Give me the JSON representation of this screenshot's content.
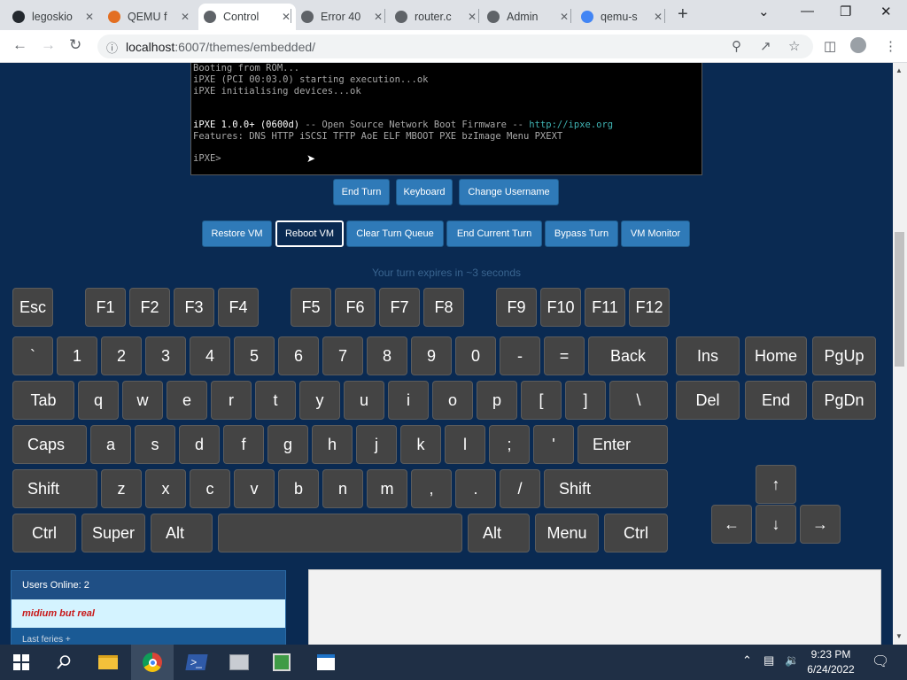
{
  "browser": {
    "tabs": [
      {
        "title": "legoskio",
        "icon": "github-icon",
        "color": "#24292f"
      },
      {
        "title": "QEMU f",
        "icon": "qemu-icon",
        "color": "#e36f22"
      },
      {
        "title": "Control",
        "icon": "globe-icon",
        "color": "#5f6368",
        "active": true
      },
      {
        "title": "Error 40",
        "icon": "globe-icon",
        "color": "#5f6368"
      },
      {
        "title": "router.c",
        "icon": "globe-icon",
        "color": "#5f6368"
      },
      {
        "title": "Admin",
        "icon": "globe-icon",
        "color": "#5f6368"
      },
      {
        "title": "qemu-s",
        "icon": "search-icon",
        "color": "#4285f4"
      }
    ],
    "url_host": "localhost",
    "url_path": ":6007/themes/embedded/"
  },
  "vm_console": {
    "lines": [
      "Booting from ROM...",
      "iPXE (PCI 00:03.0) starting execution...ok",
      "iPXE initialising devices...ok",
      "",
      "",
      "",
      "Features: DNS HTTP iSCSI TFTP AoE ELF MBOOT PXE bzImage Menu PXEXT",
      "",
      "iPXE>"
    ],
    "banner_prefix": "iPXE 1.0.0+ (0600d)",
    "banner_middle": " -- Open Source Network Boot Firmware -- ",
    "banner_link": "http://ipxe.org"
  },
  "controls": {
    "end_turn": "End Turn",
    "keyboard": "Keyboard",
    "change_username": "Change Username"
  },
  "admin": {
    "restore_vm": "Restore VM",
    "reboot_vm": "Reboot VM",
    "clear_turn_queue": "Clear Turn Queue",
    "end_current_turn": "End Current Turn",
    "bypass_turn": "Bypass Turn",
    "vm_monitor": "VM Monitor"
  },
  "turn_message": "Your turn expires in ~3 seconds",
  "keyboard": {
    "keys": [
      "Esc",
      "F1",
      "F2",
      "F3",
      "F4",
      "F5",
      "F6",
      "F7",
      "F8",
      "F9",
      "F10",
      "F11",
      "F12",
      "`",
      "1",
      "2",
      "3",
      "4",
      "5",
      "6",
      "7",
      "8",
      "9",
      "0",
      "-",
      "=",
      "Back",
      "Ins",
      "Home",
      "PgUp",
      "Tab",
      "q",
      "w",
      "e",
      "r",
      "t",
      "y",
      "u",
      "i",
      "o",
      "p",
      "[",
      "]",
      "\\",
      "Del",
      "End",
      "PgDn",
      "Caps",
      "a",
      "s",
      "d",
      "f",
      "g",
      "h",
      "j",
      "k",
      "l",
      ";",
      "'",
      "Enter",
      "Shift",
      "z",
      "x",
      "c",
      "v",
      "b",
      "n",
      "m",
      ",",
      ".",
      "/",
      "Shift",
      "↑",
      "Ctrl",
      "Super",
      "Alt",
      "",
      "Alt",
      "Menu",
      "Ctrl",
      "←",
      "↓",
      "→"
    ]
  },
  "users": {
    "header": "Users Online: 2",
    "list": [
      "midium but real"
    ],
    "more": "Last feries +"
  },
  "taskbar": {
    "time": "9:23 PM",
    "date": "6/24/2022"
  }
}
